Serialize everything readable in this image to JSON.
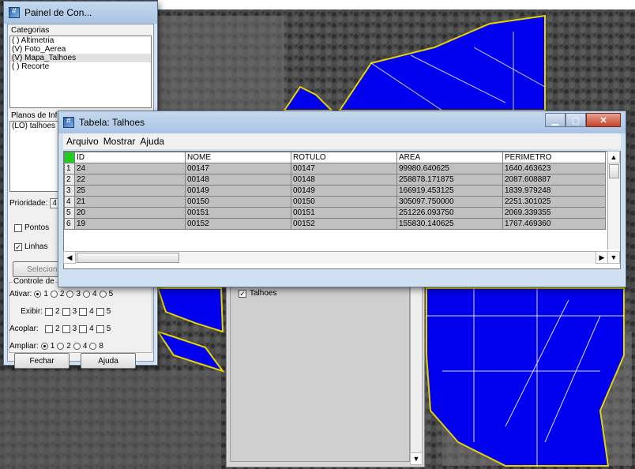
{
  "painel": {
    "title": "Painel de Con...",
    "categorias_label": "Categorias",
    "categorias": [
      {
        "label": "( ) Altimetria",
        "selected": false
      },
      {
        "label": "(V) Foto_Aerea",
        "selected": false
      },
      {
        "label": "(V) Mapa_Talhoes",
        "selected": true
      },
      {
        "label": "( ) Recorte",
        "selected": false
      }
    ],
    "planos_label": "Planos de Info",
    "planos": [
      {
        "label": "(LO) talhoes"
      }
    ],
    "prioridade_label": "Prioridade:",
    "prioridade_value": "4",
    "pontos_label": "Pontos",
    "linhas_label": "Linhas",
    "seleciona_label": "Seleciona",
    "controle_label": "Controle de",
    "ativar_label": "Ativar:",
    "ativar_opts": [
      "1",
      "2",
      "3",
      "4",
      "5"
    ],
    "exibir_label": "Exibir:",
    "exibir_opts": [
      "2",
      "3",
      "4",
      "5"
    ],
    "acoplar_label": "Acoplar:",
    "acoplar_opts": [
      "2",
      "3",
      "4",
      "5"
    ],
    "ampliar_label": "Ampliar:",
    "ampliar_opts": [
      "1",
      "2",
      "4",
      "8"
    ],
    "fechar_label": "Fechar",
    "ajuda_label": "Ajuda"
  },
  "legend": {
    "item_label": "Talhoes"
  },
  "tabela": {
    "title": "Tabela: Talhoes",
    "menu": [
      "Arquivo",
      "Mostrar",
      "Ajuda"
    ],
    "columns": [
      "ID",
      "NOME",
      "ROTULO",
      "AREA",
      "PERIMETRO"
    ],
    "rows": [
      {
        "n": "1",
        "cells": [
          "24",
          "00147",
          "00147",
          "99980.640625",
          "1640.463623"
        ]
      },
      {
        "n": "2",
        "cells": [
          "22",
          "00148",
          "00148",
          "258878.171875",
          "2087.608887"
        ]
      },
      {
        "n": "3",
        "cells": [
          "25",
          "00149",
          "00149",
          "166919.453125",
          "1839.979248"
        ]
      },
      {
        "n": "4",
        "cells": [
          "21",
          "00150",
          "00150",
          "305097.750000",
          "2251.301025"
        ]
      },
      {
        "n": "5",
        "cells": [
          "20",
          "00151",
          "00151",
          "251226.093750",
          "2069.339355"
        ]
      },
      {
        "n": "6",
        "cells": [
          "19",
          "00152",
          "00152",
          "155830.140625",
          "1767.469360"
        ]
      }
    ]
  },
  "colors": {
    "field_fill": "#0000ee",
    "field_outline": "#e6d200",
    "table_header_corner": "#22cc22"
  }
}
